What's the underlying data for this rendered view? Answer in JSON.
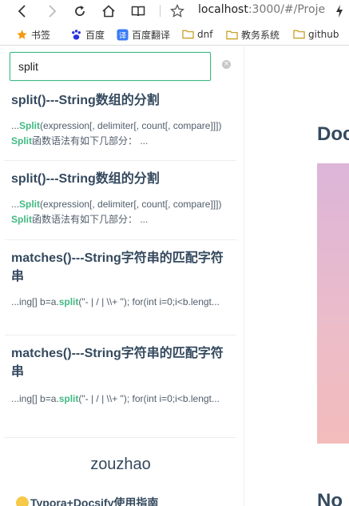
{
  "browser": {
    "url_host": "localhost",
    "url_rest": ":3000/#/Proje",
    "bookmarks": [
      {
        "label": "书签",
        "icon": "star-icon"
      },
      {
        "label": "百度",
        "icon": "baidu-paw-icon"
      },
      {
        "label": "百度翻译",
        "icon": "baidu-translate-icon"
      },
      {
        "label": "dnf",
        "icon": "folder-icon"
      },
      {
        "label": "教务系统",
        "icon": "folder-icon"
      },
      {
        "label": "github",
        "icon": "folder-icon"
      }
    ]
  },
  "search": {
    "value": "split"
  },
  "results": [
    {
      "title": "split()---String数组的分割",
      "snippet_pre": "...",
      "snippet_hl1": "Split",
      "snippet_mid": "(expression[, delimiter[, count[, compare]]]) ",
      "snippet_hl2": "Split",
      "snippet_post": "函数语法有如下几部分： ..."
    },
    {
      "title": "split()---String数组的分割",
      "snippet_pre": "...",
      "snippet_hl1": "Split",
      "snippet_mid": "(expression[, delimiter[, count[, compare]]]) ",
      "snippet_hl2": "Split",
      "snippet_post": "函数语法有如下几部分： ..."
    },
    {
      "title": "matches()---String字符串的匹配字符串",
      "snippet_pre": "...ing[] b=a.",
      "snippet_hl1": "split",
      "snippet_mid": "(\"- | / | \\\\+ \"); for(int i=0;i<b.lengt...",
      "snippet_hl2": "",
      "snippet_post": ""
    },
    {
      "title": "matches()---String字符串的匹配字符串",
      "snippet_pre": "...ing[] b=a.",
      "snippet_hl1": "split",
      "snippet_mid": "(\"- | / | \\\\+ \"); for(int i=0;i<b.lengt...",
      "snippet_hl2": "",
      "snippet_post": ""
    }
  ],
  "sidebar": {
    "site_name": "zouzhao",
    "doc_link": "Typora+Docsify使用指南"
  },
  "main": {
    "heading": "Doc",
    "heading2": "No"
  },
  "colors": {
    "accent": "#42b983",
    "text": "#34495e"
  }
}
